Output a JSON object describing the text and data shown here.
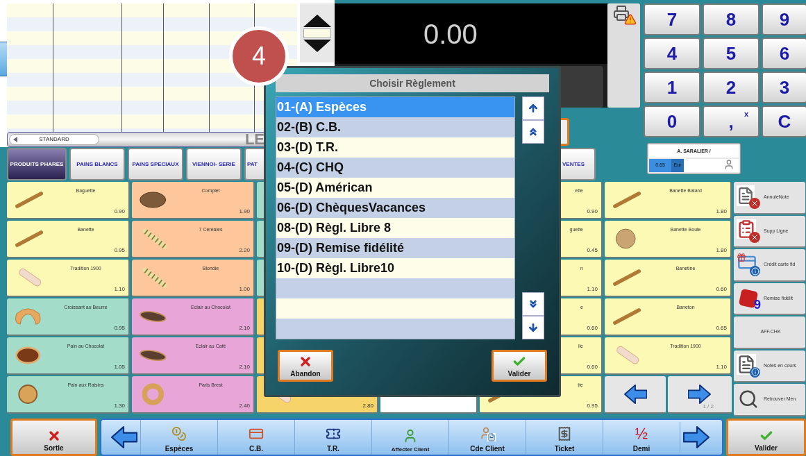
{
  "badge": "4",
  "display": {
    "amount": "0.00"
  },
  "keypad": [
    {
      "label": "7"
    },
    {
      "label": "8"
    },
    {
      "label": "9"
    },
    {
      "label": "4"
    },
    {
      "label": "5"
    },
    {
      "label": "6"
    },
    {
      "label": "1"
    },
    {
      "label": "2"
    },
    {
      "label": "3"
    },
    {
      "label": "0"
    },
    {
      "label": ",",
      "superscript": "x"
    },
    {
      "label": "C"
    }
  ],
  "cashier": {
    "name": "A. SARALIER /",
    "amount": "0.65",
    "currency": "Eur"
  },
  "price_mode": {
    "label": "STANDARD",
    "banner": "LE"
  },
  "categories": [
    {
      "label": "PRODUITS PHARES",
      "selected": true
    },
    {
      "label": "PAINS BLANCS",
      "selected": false
    },
    {
      "label": "PAINS SPECIAUX",
      "selected": false
    },
    {
      "label": "VIENNOI- SERIE",
      "selected": false
    },
    {
      "label": "PAT",
      "selected": false
    },
    {
      "label": "VENTES",
      "selected": false
    }
  ],
  "product_columns": [
    {
      "tiles": [
        {
          "name": "Baguette",
          "price": "0.90",
          "color": "#fcf9b5",
          "kind": "baguette"
        },
        {
          "name": "Banette",
          "price": "0.95",
          "color": "#fcf9b5",
          "kind": "baguette"
        },
        {
          "name": "Tradition 1900",
          "price": "1.10",
          "color": "#fcf9b5",
          "kind": "tradition"
        },
        {
          "name": "Croissant au Beurre",
          "price": "0.95",
          "color": "#a3dcc9",
          "kind": "croissant"
        },
        {
          "name": "Pain au Chocolat",
          "price": "1.05",
          "color": "#a3dcc9",
          "kind": "roll"
        },
        {
          "name": "Pain aux Raisins",
          "price": "1.30",
          "color": "#a3dcc9",
          "kind": "raisin"
        }
      ]
    },
    {
      "tiles": [
        {
          "name": "Complet",
          "price": "1.90",
          "color": "#fdc79b",
          "kind": "loaf"
        },
        {
          "name": "7 Céréales",
          "price": "2.20",
          "color": "#fdc79b",
          "kind": "striped"
        },
        {
          "name": "Blondie",
          "price": "1.00",
          "color": "#fdc79b",
          "kind": "striped"
        },
        {
          "name": "Eclair au Chocolat",
          "price": "2.10",
          "color": "#e8a6d8",
          "kind": "eclair"
        },
        {
          "name": "Eclair au Café",
          "price": "2.10",
          "color": "#e8a6d8",
          "kind": "eclair"
        },
        {
          "name": "Paris Brest",
          "price": "2.40",
          "color": "#e8a6d8",
          "kind": "ring"
        }
      ]
    },
    {
      "tiles": [
        {
          "color": "#a3dcc9"
        },
        {
          "color": "#a3dcc9"
        },
        {
          "color": "#a3dcc9"
        },
        {
          "color": "#f6d46a"
        },
        {
          "color": "#f6d46a"
        },
        {
          "price": "2.80",
          "color": "#f6d46a",
          "kind": "tradition"
        }
      ]
    },
    {
      "tiles": [
        {
          "color": "#ffffff"
        }
      ]
    },
    {
      "tiles": [
        {
          "name": "ette",
          "price": "0.90",
          "color": "#fcf9b5"
        },
        {
          "name": "guette",
          "price": "0.45",
          "color": "#fcf9b5"
        },
        {
          "name": "n",
          "price": "1.10",
          "color": "#fcf9b5"
        },
        {
          "name": "e",
          "price": "0.60",
          "color": "#fcf9b5"
        },
        {
          "name": "lle",
          "price": "0.60",
          "color": "#fcf9b5"
        },
        {
          "name": "tte",
          "price": "0.95",
          "color": "#fcf9b5",
          "kind": "baguette"
        }
      ]
    },
    {
      "tiles": [
        {
          "name": "Banette Batard",
          "price": "1.80",
          "color": "#fcf9b5",
          "kind": "baguette"
        },
        {
          "name": "Banette Boule",
          "price": "1.80",
          "color": "#fcf9b5",
          "kind": "boule"
        },
        {
          "name": "Banetine",
          "price": "0.60",
          "color": "#fcf9b5",
          "kind": "baguette"
        },
        {
          "name": "Baneton",
          "price": "0.65",
          "color": "#fcf9b5",
          "kind": "baguette"
        },
        {
          "name": "Tradition 1900",
          "price": "1.10",
          "color": "#fcf9b5",
          "kind": "tradition"
        }
      ]
    }
  ],
  "pager": {
    "page": "1 / 2"
  },
  "side_actions": [
    {
      "label": "AnnuleNote",
      "kind": "note-cancel"
    },
    {
      "label": "Supp Ligne",
      "kind": "list-cancel"
    },
    {
      "label": "Crédit carte fid",
      "kind": "gift-card"
    },
    {
      "label": "Remise fidélit",
      "kind": "die",
      "badge": "9"
    },
    {
      "label": "AFF.CHK"
    },
    {
      "label": "Notes en cours",
      "kind": "notes-info"
    },
    {
      "label": "Retrouver Men",
      "kind": "magnifier"
    }
  ],
  "toolbar": {
    "exit": "Sortie",
    "confirm": "Valider",
    "items": [
      {
        "label": "Espèces",
        "kind": "coins"
      },
      {
        "label": "C.B.",
        "kind": "card"
      },
      {
        "label": "T.R.",
        "kind": "ticket"
      },
      {
        "label": "Affecter Client",
        "kind": "person"
      },
      {
        "label": "Cde Client",
        "kind": "person-doc"
      },
      {
        "label": "Ticket",
        "kind": "receipt"
      },
      {
        "label": "Demi",
        "kind": "half",
        "icon_text": "½"
      }
    ]
  },
  "dialog": {
    "title": "Choisir Règlement",
    "cancel": "Abandon",
    "confirm": "Valider",
    "options": [
      {
        "label": "01-(A) Espèces",
        "selected": true
      },
      {
        "label": "02-(B) C.B.",
        "selected": false
      },
      {
        "label": "03-(D) T.R.",
        "selected": false
      },
      {
        "label": "04-(C) CHQ",
        "selected": false
      },
      {
        "label": "05-(D) Américan",
        "selected": false
      },
      {
        "label": "06-(D) ChèquesVacances",
        "selected": false
      },
      {
        "label": "08-(D) Règl. Libre 8",
        "selected": false
      },
      {
        "label": "09-(D) Remise fidélité",
        "selected": false
      },
      {
        "label": "10-(D) Règl. Libre10",
        "selected": false
      }
    ]
  }
}
